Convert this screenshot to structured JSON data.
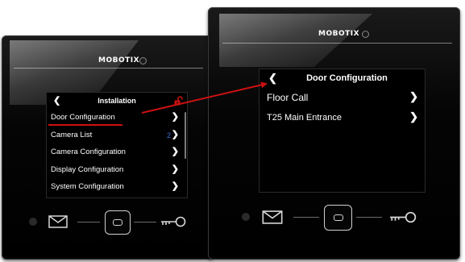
{
  "brand": "MOBOTIX",
  "left_screen": {
    "title": "Installation",
    "back_icon": "chevron-left-icon",
    "lock_icon": "open-lock-icon",
    "lock_color": "#cc1111",
    "items": [
      {
        "label": "Door Configuration",
        "count": "",
        "highlighted": true
      },
      {
        "label": "Camera List",
        "count": "2",
        "highlighted": false
      },
      {
        "label": "Camera Configuration",
        "count": "",
        "highlighted": false
      },
      {
        "label": "Display Configuration",
        "count": "",
        "highlighted": false
      },
      {
        "label": "System Configuration",
        "count": "",
        "highlighted": false
      }
    ],
    "count_color": "#3a6ed8"
  },
  "right_screen": {
    "title": "Door Configuration",
    "back_icon": "chevron-left-icon",
    "items": [
      {
        "label": "Floor Call"
      },
      {
        "label": "T25 Main Entrance"
      }
    ]
  },
  "hardware_buttons": [
    "mail-icon",
    "home-button",
    "key-icon"
  ],
  "annotation": {
    "arrow_color": "#cc1111",
    "underline_color": "#cc1111"
  }
}
